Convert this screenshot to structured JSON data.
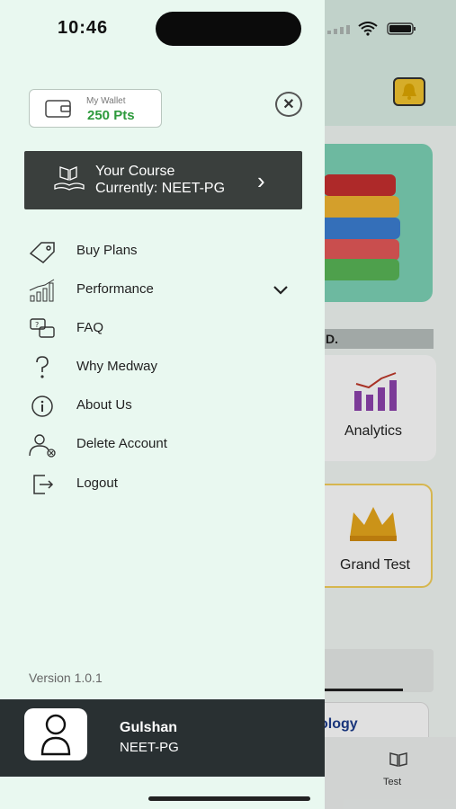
{
  "status_bar": {
    "time": "10:46"
  },
  "background": {
    "strip_text": "D.",
    "tiles": [
      {
        "label": "Analytics",
        "icon": "analytics-chart-icon"
      },
      {
        "label": "Grand Test",
        "icon": "crown-icon"
      }
    ],
    "partial_card_text": "ology",
    "bottom_tab": {
      "label": "Test",
      "icon": "book-icon"
    }
  },
  "drawer": {
    "wallet": {
      "label": "My Wallet",
      "value": "250 Pts",
      "icon": "wallet-icon"
    },
    "close_icon": "close-icon",
    "course": {
      "title": "Your Course",
      "subtitle": "Currently: NEET-PG",
      "icon": "open-book-hand-icon",
      "chevron": "›"
    },
    "menu": [
      {
        "label": "Buy Plans",
        "icon": "tag-icon"
      },
      {
        "label": "Performance",
        "icon": "bar-chart-icon",
        "expandable": true
      },
      {
        "label": "FAQ",
        "icon": "faq-icon"
      },
      {
        "label": "Why Medway",
        "icon": "question-icon"
      },
      {
        "label": "About Us",
        "icon": "info-icon"
      },
      {
        "label": "Delete Account",
        "icon": "delete-user-icon"
      },
      {
        "label": "Logout",
        "icon": "logout-icon"
      }
    ],
    "version": "Version 1.0.1",
    "profile": {
      "name": "Gulshan",
      "course": "NEET-PG",
      "icon": "user-avatar-icon"
    }
  },
  "colors": {
    "drawer_bg": "#e9f8f0",
    "dark": "#3a3f3d",
    "profile_bg": "#293032",
    "wallet_green": "#2d9a3c"
  }
}
